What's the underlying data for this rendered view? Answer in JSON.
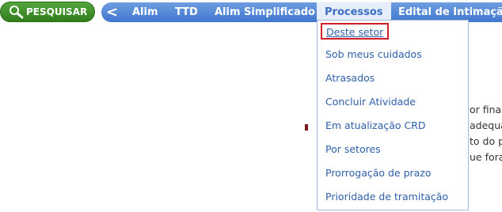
{
  "search_button": {
    "label": "PESQUISAR",
    "icon": "magnifier-icon"
  },
  "navbar": {
    "back_label": "<",
    "items": [
      {
        "label": "Alim"
      },
      {
        "label": "TTD"
      },
      {
        "label": "Alim Simplificado"
      },
      {
        "label": "Processos",
        "active": true
      },
      {
        "label": "Edital de Intimação"
      }
    ]
  },
  "processos_menu": {
    "items": [
      {
        "label": "Deste setor",
        "highlighted": true
      },
      {
        "label": "Sob meus cuidados"
      },
      {
        "label": "Atrasados"
      },
      {
        "label": "Concluir Atividade"
      },
      {
        "label": "Em atualização CRD"
      },
      {
        "label": "Por setores"
      },
      {
        "label": "Prorrogação de prazo"
      },
      {
        "label": "Prioridade de tramitação"
      }
    ]
  },
  "background_text": [
    "or final",
    "adequa",
    "to do p",
    "ue foran"
  ],
  "colors": {
    "search_green": "#3a8a25",
    "nav_blue": "#4f86d6",
    "menu_link": "#2f5fa8",
    "highlight_border": "#d11d25"
  }
}
